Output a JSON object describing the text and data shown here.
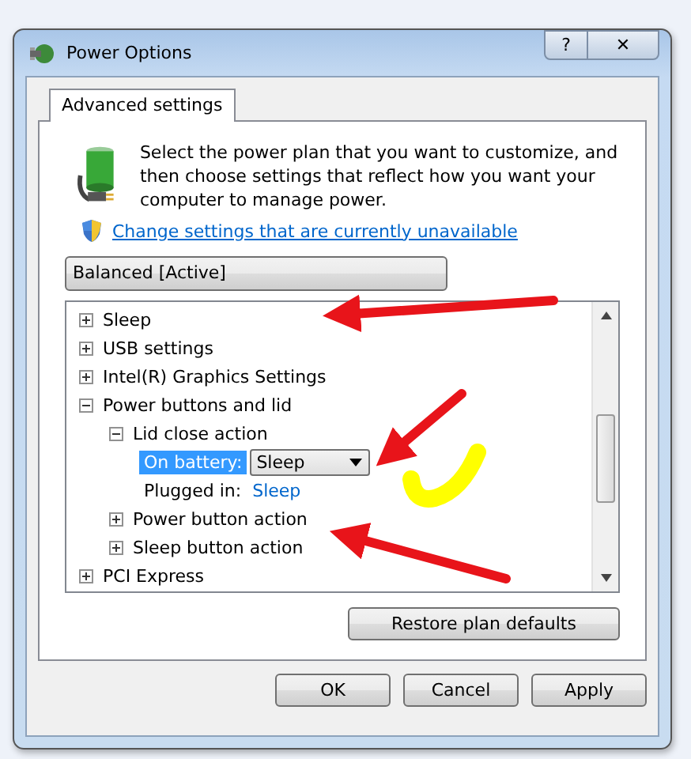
{
  "window": {
    "title": "Power Options",
    "help_button": "?",
    "close_button": "✕"
  },
  "tabs": [
    {
      "label": "Advanced settings",
      "selected": true
    }
  ],
  "intro": "Select the power plan that you want to customize, and then choose settings that reflect how you want your computer to manage power.",
  "change_link": "Change settings that are currently unavailable",
  "plan_dropdown": {
    "value": "Balanced [Active]"
  },
  "tree": [
    {
      "label": "Sleep",
      "expanded": false
    },
    {
      "label": "USB settings",
      "expanded": false
    },
    {
      "label": "Intel(R) Graphics Settings",
      "expanded": false
    },
    {
      "label": "Power buttons and lid",
      "expanded": true,
      "children": [
        {
          "label": "Lid close action",
          "expanded": true,
          "children": [
            {
              "kind": "dropdown",
              "label": "On battery:",
              "value": "Sleep",
              "selected": true
            },
            {
              "kind": "link",
              "label": "Plugged in:",
              "value": "Sleep",
              "selected": false
            }
          ]
        },
        {
          "label": "Power button action",
          "expanded": false
        },
        {
          "label": "Sleep button action",
          "expanded": false
        }
      ]
    },
    {
      "label": "PCI Express",
      "expanded": false
    }
  ],
  "restore_button": "Restore plan defaults",
  "buttons": [
    "OK",
    "Cancel",
    "Apply"
  ]
}
